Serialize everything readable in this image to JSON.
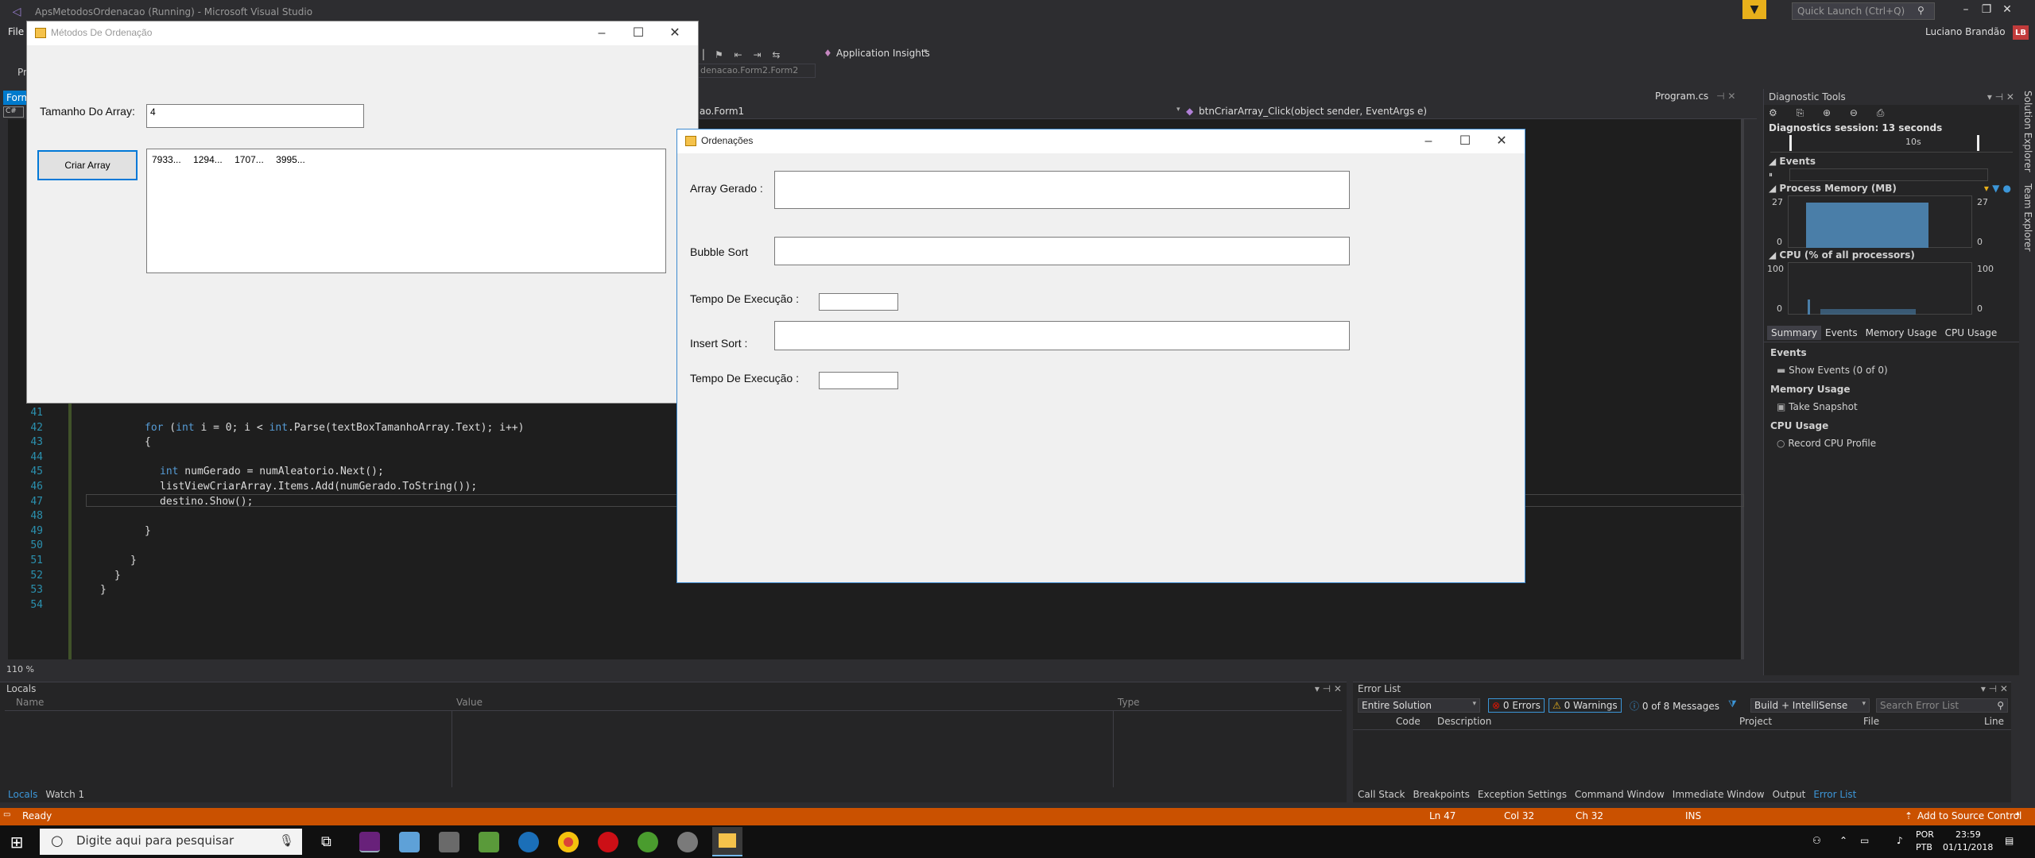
{
  "window": {
    "title": "ApsMetodosOrdenacao (Running) - Microsoft Visual Studio",
    "quick_launch_placeholder": "Quick Launch (Ctrl+Q)",
    "user": "Luciano Brandão",
    "user_initials": "LB"
  },
  "menu": {
    "file": "File",
    "pr": "Pr"
  },
  "toolbar": {
    "application_insights": "Application Insights",
    "nav_combo": "denacao.Form2.Form2"
  },
  "editor": {
    "tab_form": "Form",
    "file_tab": "Program.cs",
    "class_combo": "ao.Form1",
    "member_combo": "btnCriarArray_Click(object sender, EventArgs e)",
    "zoom": "110 %",
    "lines": [
      {
        "n": "41",
        "code": ""
      },
      {
        "n": "42",
        "code": "for (int i = 0; i < int.Parse(textBoxTamanhoArray.Text); i++)"
      },
      {
        "n": "43",
        "code": "{"
      },
      {
        "n": "44",
        "code": ""
      },
      {
        "n": "45",
        "code": "int numGerado = numAleatorio.Next();"
      },
      {
        "n": "46",
        "code": "listViewCriarArray.Items.Add(numGerado.ToString());"
      },
      {
        "n": "47",
        "code": "destino.Show();"
      },
      {
        "n": "48",
        "code": ""
      },
      {
        "n": "49",
        "code": "}"
      },
      {
        "n": "50",
        "code": ""
      },
      {
        "n": "51",
        "code": "}"
      },
      {
        "n": "52",
        "code": "}"
      },
      {
        "n": "53",
        "code": "}"
      },
      {
        "n": "54",
        "code": ""
      }
    ]
  },
  "form_metodos": {
    "title": "Métodos De Ordenação",
    "size_label": "Tamanho Do Array:",
    "size_value": "4",
    "button": "Criar Array",
    "items": [
      "7933...",
      "1294...",
      "1707...",
      "3995..."
    ]
  },
  "form_ordenacoes": {
    "title": "Ordenações",
    "array_gerado": "Array Gerado :",
    "bubble_sort": "Bubble Sort",
    "tempo1": "Tempo De Execução :",
    "insert_sort": "Insert Sort :",
    "tempo2": "Tempo De Execução :"
  },
  "diagnostics": {
    "title": "Diagnostic Tools",
    "session": "Diagnostics session: 13 seconds",
    "timeline_label": "10s",
    "events": "Events",
    "process_memory": "Process Memory (MB)",
    "mem_max": "27",
    "mem_min": "0",
    "cpu": "CPU (% of all processors)",
    "cpu_max": "100",
    "cpu_min": "0",
    "tabs": [
      "Summary",
      "Events",
      "Memory Usage",
      "CPU Usage"
    ],
    "sec_events": "Events",
    "show_events": "Show Events (0 of 0)",
    "sec_memory": "Memory Usage",
    "take_snapshot": "Take Snapshot",
    "sec_cpu": "CPU Usage",
    "record_cpu": "Record CPU Profile"
  },
  "side_tabs": {
    "solution_explorer": "Solution Explorer",
    "team_explorer": "Team Explorer"
  },
  "locals": {
    "title": "Locals",
    "col_name": "Name",
    "col_value": "Value",
    "col_type": "Type",
    "tabs": [
      "Locals",
      "Watch 1"
    ]
  },
  "error_list": {
    "title": "Error List",
    "scope": "Entire Solution",
    "errors": "0 Errors",
    "warnings": "0 Warnings",
    "messages": "0 of 8 Messages",
    "build": "Build + IntelliSense",
    "search_placeholder": "Search Error List",
    "col_code": "Code",
    "col_description": "Description",
    "col_project": "Project",
    "col_file": "File",
    "col_line": "Line",
    "tabs": [
      "Call Stack",
      "Breakpoints",
      "Exception Settings",
      "Command Window",
      "Immediate Window",
      "Output",
      "Error List"
    ]
  },
  "status": {
    "ready": "Ready",
    "ln": "Ln 47",
    "col": "Col 32",
    "ch": "Ch 32",
    "ins": "INS",
    "source_control": "Add to Source Control"
  },
  "taskbar": {
    "search_placeholder": "Digite aqui para pesquisar",
    "lang1": "POR",
    "lang2": "PTB",
    "time": "23:59",
    "date": "01/11/2018"
  },
  "colors": {
    "status_bar": "#ca5100",
    "accent": "#0078d7",
    "filter": "#e8b01b"
  }
}
